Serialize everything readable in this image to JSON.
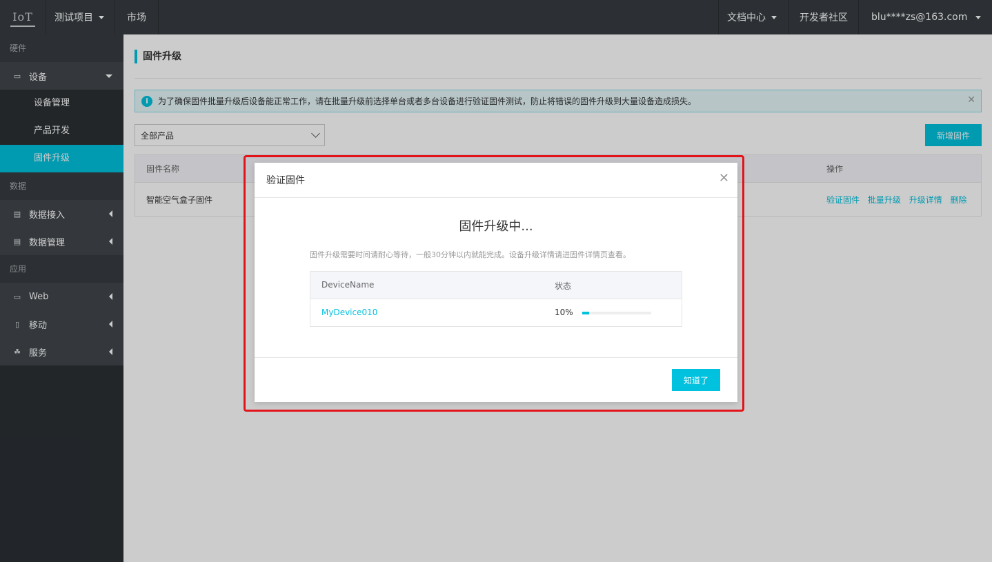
{
  "header": {
    "project": "测试项目",
    "market": "市场",
    "docs": "文档中心",
    "community": "开发者社区",
    "user": "blu****zs@163.com"
  },
  "sidebar": {
    "hardware": "硬件",
    "device": "设备",
    "device_mgmt": "设备管理",
    "product_dev": "产品开发",
    "firmware_upgrade": "固件升级",
    "data": "数据",
    "data_access": "数据接入",
    "data_mgmt": "数据管理",
    "apps": "应用",
    "web": "Web",
    "mobile": "移动",
    "service": "服务"
  },
  "main": {
    "title": "固件升级",
    "notice": "为了确保固件批量升级后设备能正常工作，请在批量升级前选择单台或者多台设备进行验证固件测试，防止将错误的固件升级到大量设备造成损失。",
    "select_value": "全部产品",
    "add_button": "新增固件",
    "table": {
      "col_name": "固件名称",
      "col_ops": "操作",
      "row_name": "智能空气盒子固件",
      "ops": [
        "验证固件",
        "批量升级",
        "升级详情",
        "删除"
      ]
    }
  },
  "modal": {
    "title": "验证固件",
    "heading": "固件升级中...",
    "description": "固件升级需要时间请耐心等待，一般30分钟以内就能完成。设备升级详情请进固件详情页查看。",
    "col_device": "DeviceName",
    "col_status": "状态",
    "device": "MyDevice010",
    "progress_text": "10%",
    "progress_value": 0.1,
    "ok_button": "知道了"
  },
  "colors": {
    "accent": "#00c1de",
    "highlight_border": "#e2141a",
    "topbar": "#373d41",
    "sidebar": "#2b3034"
  }
}
